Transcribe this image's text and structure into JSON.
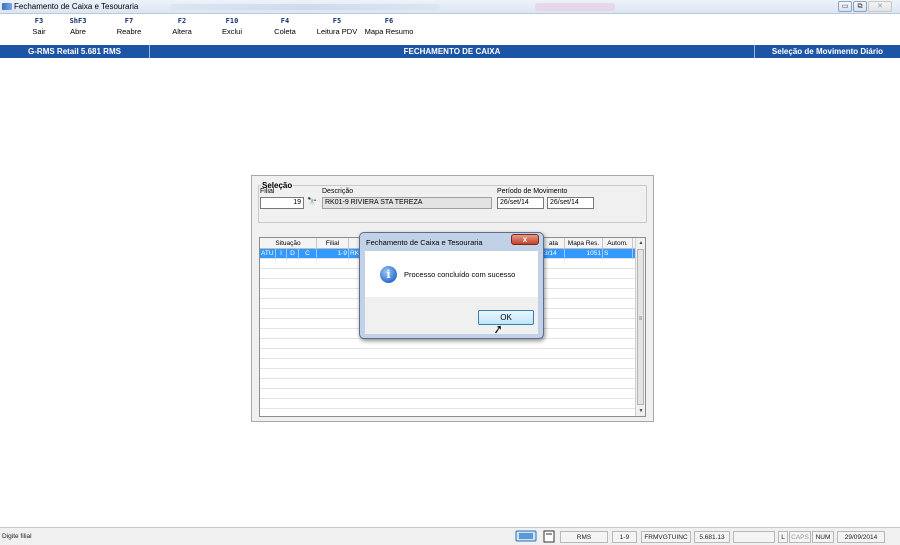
{
  "window": {
    "title": "Fechamento de Caixa e Tesouraria",
    "min_glyph": "▭",
    "max_glyph": "⧉",
    "close_glyph": "✕"
  },
  "toolbar": {
    "buttons": [
      {
        "key": "F3",
        "label": "Sair"
      },
      {
        "key": "ShF3",
        "label": "Abre"
      },
      {
        "key": "F7",
        "label": "Reabre"
      },
      {
        "key": "F2",
        "label": "Altera"
      },
      {
        "key": "F10",
        "label": "Exclui"
      },
      {
        "key": "F4",
        "label": "Coleta"
      },
      {
        "key": "F5",
        "label": "Leitura PDV"
      },
      {
        "key": "F6",
        "label": "Mapa Resumo"
      }
    ]
  },
  "header": {
    "left": "G-RMS Retail 5.681 RMS",
    "center": "FECHAMENTO DE CAIXA",
    "right": "Seleção de Movimento Diário"
  },
  "selecao": {
    "legend": "Seleção",
    "filial_label": "Filial",
    "filial_value": "19",
    "descricao_label": "Descrição",
    "descricao_value": "RK01-9 RIVIERA STA TEREZA",
    "periodo_label": "Período de Movimento",
    "periodo_inicio": "26/set/14",
    "periodo_fim": "26/set/14"
  },
  "grid": {
    "headers": [
      "Situação",
      "Filial",
      "ata",
      "Mapa Res.",
      "Autom."
    ],
    "rows": [
      {
        "sit1": "ATU",
        "sit2": "I",
        "sit3": "D",
        "sit4": "C",
        "filial": "1-9",
        "desc": "RK",
        "data": "3/14",
        "mapa": "1051",
        "autom": "S"
      }
    ]
  },
  "dialog": {
    "title": "Fechamento de Caixa e Tesouraria",
    "close_glyph": "x",
    "message": "Processo concluído com sucesso",
    "ok_label": "OK"
  },
  "status": {
    "message": "Digite filial",
    "system": "RMS",
    "filial": "1-9",
    "program": "FRMVGTUINC",
    "version": "5.681.13",
    "l": "L",
    "caps": "CAPS",
    "num": "NUM",
    "date": "29/09/2014"
  }
}
